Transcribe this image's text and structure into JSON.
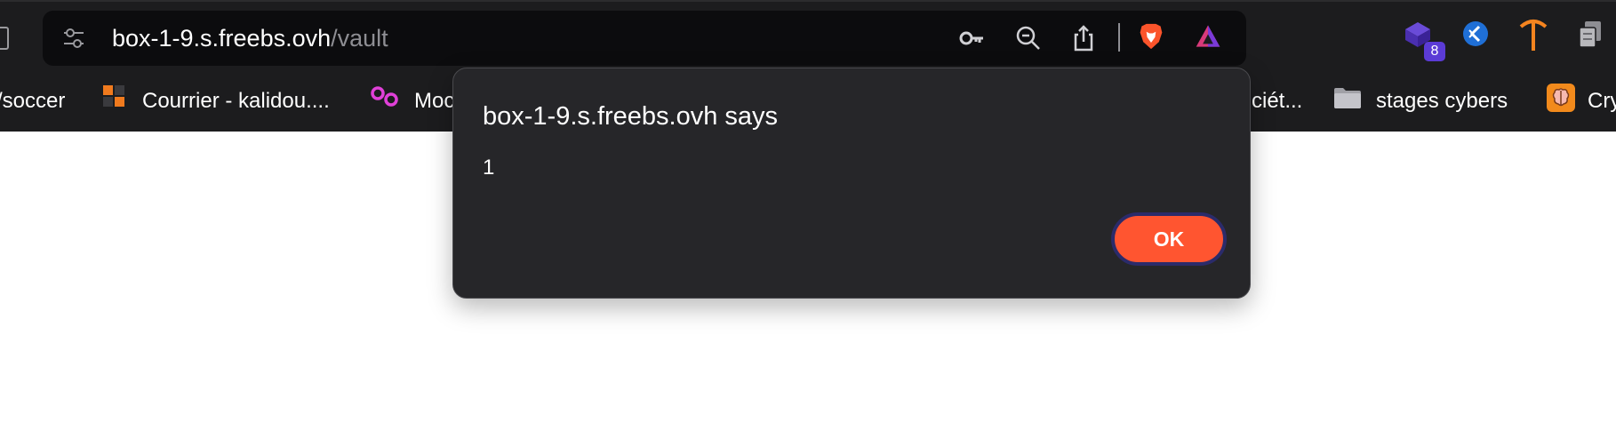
{
  "address_bar": {
    "host": "box-1-9.s.freebs.ovh",
    "path": "/vault"
  },
  "extensions": {
    "badge_count": "8"
  },
  "bookmarks": [
    {
      "label": "/soccer",
      "icon": "none"
    },
    {
      "label": "Courrier - kalidou....",
      "icon": "orange-squares-icon"
    },
    {
      "label": "Moc",
      "icon": "pink-circles-icon"
    },
    {
      "label": "ciét...",
      "icon": "none"
    },
    {
      "label": "stages cybers",
      "icon": "folder-icon"
    },
    {
      "label": "Cry",
      "icon": "brain-icon"
    }
  ],
  "dialog": {
    "title": "box-1-9.s.freebs.ovh says",
    "message": "1",
    "ok_label": "OK"
  },
  "colors": {
    "toolbar": "#1c1c1e",
    "urlbar": "#0c0c0e",
    "dialog": "#262629",
    "ok_button": "#ff5530",
    "ok_border": "#2b2b6a"
  }
}
